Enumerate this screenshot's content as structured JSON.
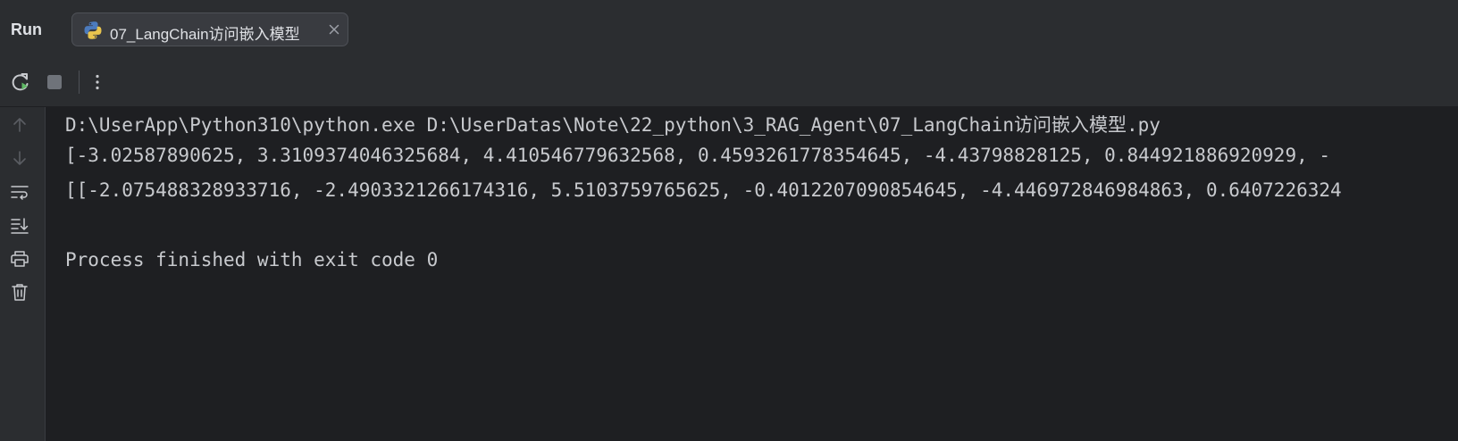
{
  "panel": {
    "title": "Run"
  },
  "tab": {
    "label": "07_LangChain访问嵌入模型",
    "icon": "python-icon",
    "close_icon": "close-icon"
  },
  "toolbar": {
    "rerun_icon": "rerun-icon",
    "stop_icon": "stop-icon",
    "more_icon": "more-vertical-icon"
  },
  "gutter": {
    "icons": [
      "up-arrow-icon",
      "down-arrow-icon",
      "soft-wrap-icon",
      "scroll-to-end-icon",
      "print-icon",
      "trash-icon"
    ]
  },
  "console": {
    "lines": [
      "D:\\UserApp\\Python310\\python.exe D:\\UserDatas\\Note\\22_python\\3_RAG_Agent\\07_LangChain访问嵌入模型.py",
      "[-3.02587890625, 3.3109374046325684, 4.410546779632568, 0.4593261778354645, -4.43798828125, 0.844921886920929, -",
      "[[-2.075488328933716, -2.4903321266174316, 5.5103759765625, -0.4012207090854645, -4.446972846984863, 0.6407226324",
      "",
      "Process finished with exit code 0"
    ]
  },
  "colors": {
    "background": "#1e1f22",
    "panel": "#2b2d30",
    "text": "#c8cace",
    "rerun_green": "#5fb865"
  }
}
